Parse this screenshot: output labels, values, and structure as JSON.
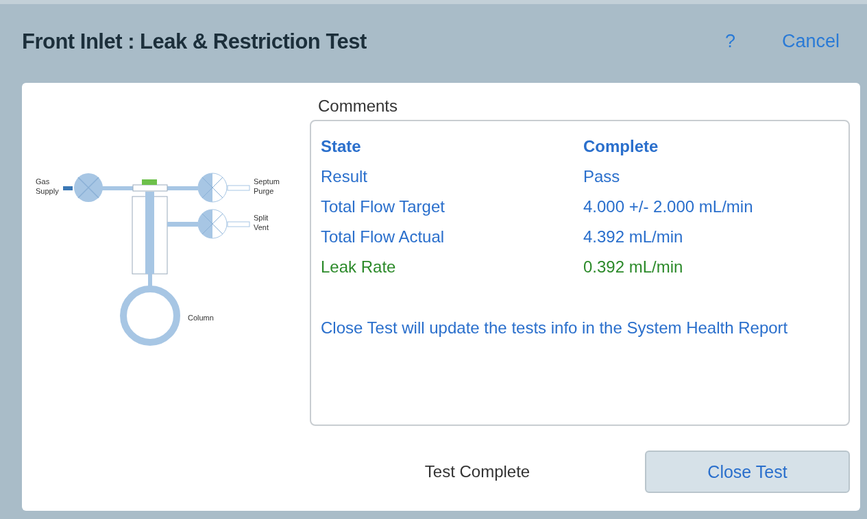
{
  "header": {
    "title": "Front Inlet : Leak & Restriction Test",
    "help": "?",
    "cancel": "Cancel"
  },
  "diagram": {
    "labels": [
      {
        "kind": "gas",
        "lines": [
          "Gas",
          "Supply"
        ]
      },
      {
        "kind": "septum",
        "lines": [
          "Septum",
          "Purge"
        ]
      },
      {
        "kind": "split",
        "lines": [
          "Split",
          "Vent"
        ]
      },
      {
        "kind": "column",
        "lines": [
          "Column"
        ]
      }
    ]
  },
  "comments": {
    "label": "Comments",
    "rows": [
      {
        "name": "State",
        "value": "Complete",
        "kind": "heading"
      },
      {
        "name": "Result",
        "value": "Pass",
        "kind": "normal"
      },
      {
        "name": "Total Flow Target",
        "value": "4.000 +/- 2.000 mL/min",
        "kind": "normal"
      },
      {
        "name": "Total Flow Actual",
        "value": "4.392 mL/min",
        "kind": "normal"
      },
      {
        "name": "Leak Rate",
        "value": "0.392 mL/min",
        "kind": "good"
      }
    ],
    "note": "Close Test will update the tests info in the System Health Report"
  },
  "footer": {
    "status": "Test Complete",
    "button": "Close Test"
  }
}
